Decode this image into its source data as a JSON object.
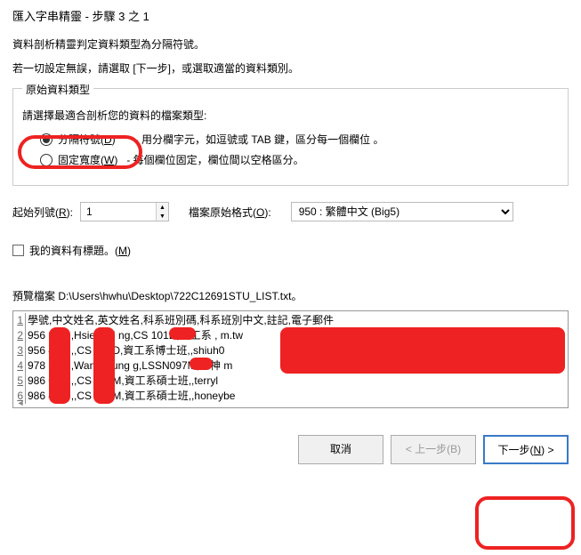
{
  "title": "匯入字串精靈 - 步驟 3 之 1",
  "desc": "資料剖析精靈判定資料類型為分隔符號。",
  "sub": "若一切設定無誤，請選取 [下一步]，或選取適當的資料類別。",
  "group_title": "原始資料類型",
  "choose_label": "請選擇最適合剖析您的資料的檔案類型:",
  "radio_delim_label_pre": "分隔符號(",
  "radio_delim_hot": "D",
  "radio_delim_label_post": ")",
  "radio_delim_desc": "- 用分欄字元，如逗號或 TAB 鍵，區分每一個欄位 。",
  "radio_fixed_label_pre": "固定寬度(",
  "radio_fixed_hot": "W",
  "radio_fixed_label_post": ")",
  "radio_fixed_desc": "- 每個欄位固定，欄位間以空格區分。",
  "start_label_pre": "起始列號(",
  "start_hot": "R",
  "start_label_post": "):",
  "start_value": "1",
  "encoding_label_pre": "檔案原始格式(",
  "encoding_hot": "O",
  "encoding_label_post": "):",
  "encoding_value": "950 : 繁體中文 (Big5)",
  "headers_label_pre": "我的資料有標題。(",
  "headers_hot": "M",
  "headers_label_post": ")",
  "preview_label": "預覽檔案 D:\\Users\\hwhu\\Desktop\\722C12691STU_LIST.txt。",
  "rows": [
    "學號,中文姓名,英文姓名,科系班別碼,科系班別中文,註記,電子郵件",
    "956    3,謝    ,Hsieh  Mi     ng,CS  101D,資工系         ,        m.tw",
    "956    4,石    ,,CS  096D,資工系博士班,,shiuh0",
    "978    3,王    ,Wang  Hung    g,LSSN097M,系神              m",
    "986    0,蔡    ,,CS  098M,資工系碩士班,,terryl",
    "986    4,吳    ,,CS  098M,資工系碩士班,,honeybe"
  ],
  "btn_cancel": "取消",
  "btn_back": "< 上一步(B)",
  "btn_next_pre": "下一步(",
  "btn_next_hot": "N",
  "btn_next_post": ") >"
}
